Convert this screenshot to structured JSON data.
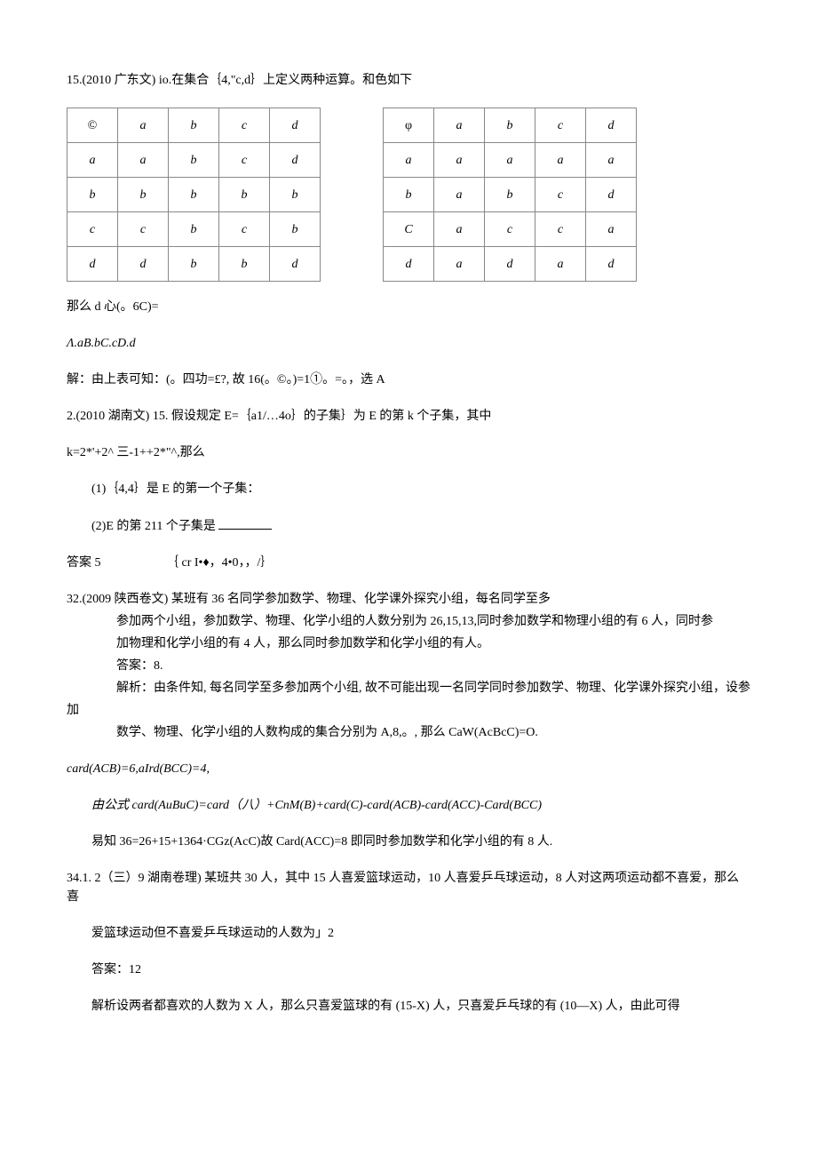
{
  "p15_intro": "15.(2010 广东文) io.在集合｛4,\"c,d｝上定义两种运算。和色如下",
  "table1": {
    "head": [
      "©",
      "a",
      "b",
      "c",
      "d"
    ],
    "rows": [
      [
        "a",
        "a",
        "b",
        "c",
        "d"
      ],
      [
        "b",
        "b",
        "b",
        "b",
        "b"
      ],
      [
        "c",
        "c",
        "b",
        "c",
        "b"
      ],
      [
        "d",
        "d",
        "b",
        "b",
        "d"
      ]
    ]
  },
  "table2": {
    "head": [
      "φ",
      "a",
      "b",
      "c",
      "d"
    ],
    "rows": [
      [
        "a",
        "a",
        "a",
        "a",
        "a"
      ],
      [
        "b",
        "a",
        "b",
        "c",
        "d"
      ],
      [
        "C",
        "a",
        "c",
        "c",
        "a"
      ],
      [
        "d",
        "a",
        "d",
        "a",
        "d"
      ]
    ]
  },
  "p15_q": "那么 d 心(。6C)=",
  "p15_choices": "Λ.aB.bC.cD.d",
  "p15_sol": "解：由上表可知：(。四功=£?, 故 16(。©。)=1①。=。，选 A",
  "p2_intro": "2.(2010 湖南文) 15. 假设规定 E=｛a1/…4o｝的子集｝为 E 的第 k 个子集，其中",
  "p2_k": "k=2*'+2^ 三-1++2*\"^,那么",
  "p2_s1": "(1)｛4,4｝是 E 的第一个子集：",
  "p2_s2a": "(2)E 的第 211 个子集是 ",
  "ans5_label": "答案 5",
  "ans5_val": "｛ cr I•♦，4•0，，/｝",
  "p32_head": "32.(2009 陕西卷文) 某班有 36 名同学参加数学、物理、化学课外探究小组，每名同学至多",
  "p32_l1": "参加两个小组，参加数学、物理、化学小组的人数分别为 26,15,13,同时参加数学和物理小组的有 6 人，同时参",
  "p32_l2": "加物理和化学小组的有 4 人，那么同时参加数学和化学小组的有人。",
  "p32_ans": "答案：8.",
  "p32_sol1": "解析：由条件知, 每名同学至多参加两个小组, 故不可能出现一名同学同时参加数学、物理、化学课外探究小组，设参",
  "p32_sol1b": "加",
  "p32_sol2": "数学、物理、化学小组的人数构成的集合分别为 A,8,。, 那么 CaW(AcBcC)=O.",
  "p32_card": "card(ACB)=6,aIrd(BCC)=4,",
  "p32_formula": "由公式 card(AuBuC)=card（八）+CnM(B)+card(C)-card(ACB)-card(ACC)-Card(BCC)",
  "p32_final": "易知 36=26+15+1364·CGz(AcC)故 Card(ACC)=8 即同时参加数学和化学小组的有 8 人.",
  "p34_head": "34.1.  2（三）9 湖南卷理) 某班共 30 人，其中 15 人喜爱篮球运动，10 人喜爱乒乓球运动，8 人对这两项运动都不喜爱，那么喜",
  "p34_l1": "爱篮球运动但不喜爱乒乓球运动的人数为」2",
  "p34_ans": "答案：12",
  "p34_sol": "解析设两者都喜欢的人数为 X 人，那么只喜爱篮球的有 (15-X) 人，只喜爱乒乓球的有 (10—X) 人，由此可得"
}
